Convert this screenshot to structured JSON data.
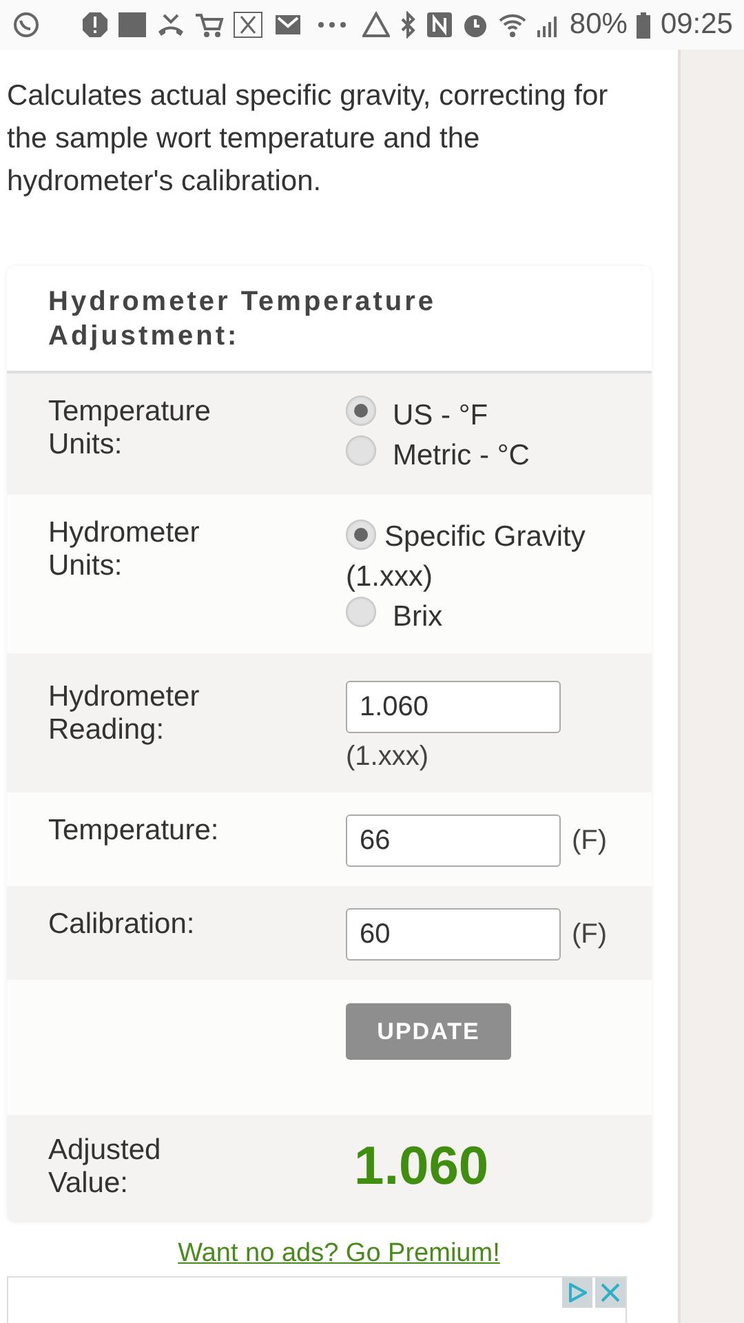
{
  "status_bar": {
    "battery": "80%",
    "time": "09:25"
  },
  "description": "Calculates actual specific gravity, correcting for the sample wort temperature and the hydrometer's calibration.",
  "form": {
    "title": "Hydrometer Temperature Adjustment:",
    "rows": [
      {
        "kind": "radio",
        "label": "Temperature Units:",
        "options": [
          {
            "label": "US - °F",
            "selected": true
          },
          {
            "label": "Metric - °C",
            "selected": false
          }
        ]
      },
      {
        "kind": "radio",
        "label": "Hydrometer Units:",
        "options": [
          {
            "label": "Specific Gravity (1.xxx)",
            "selected": true
          },
          {
            "label": "Brix",
            "selected": false
          }
        ]
      },
      {
        "kind": "input",
        "label": "Hydrometer Reading:",
        "value": "1.060",
        "note": "(1.xxx)"
      },
      {
        "kind": "input",
        "label": "Temperature:",
        "value": "66",
        "unit": "(F)"
      },
      {
        "kind": "input",
        "label": "Calibration:",
        "value": "60",
        "unit": "(F)"
      },
      {
        "kind": "button",
        "label_button": "UPDATE"
      },
      {
        "kind": "result",
        "label": "Adjusted Value:",
        "value": "1.060"
      }
    ]
  },
  "premium_link": "Want no ads? Go Premium!"
}
